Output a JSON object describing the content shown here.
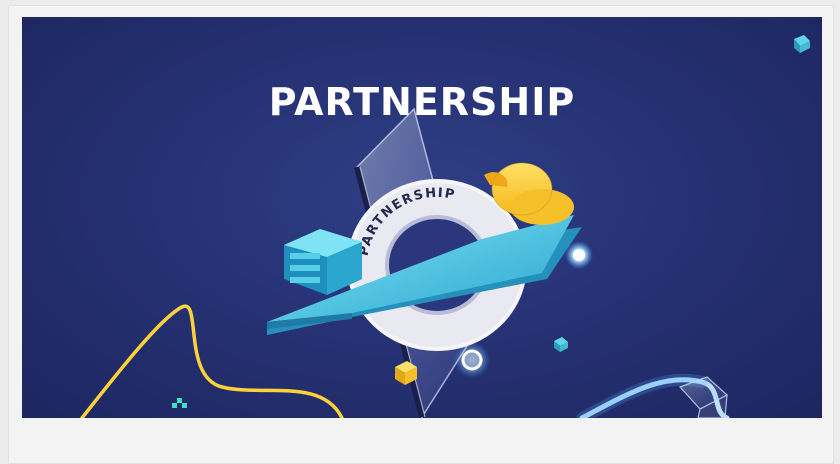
{
  "banner": {
    "headline": "PARTNERSHIP",
    "ring_text": "PARTNERSHIP",
    "colors": {
      "background": "#263274",
      "cyan": "#3fc4e0",
      "yellow": "#ffd23a",
      "ring": "#e9e9f2",
      "glow": "#8fd8ff"
    }
  }
}
